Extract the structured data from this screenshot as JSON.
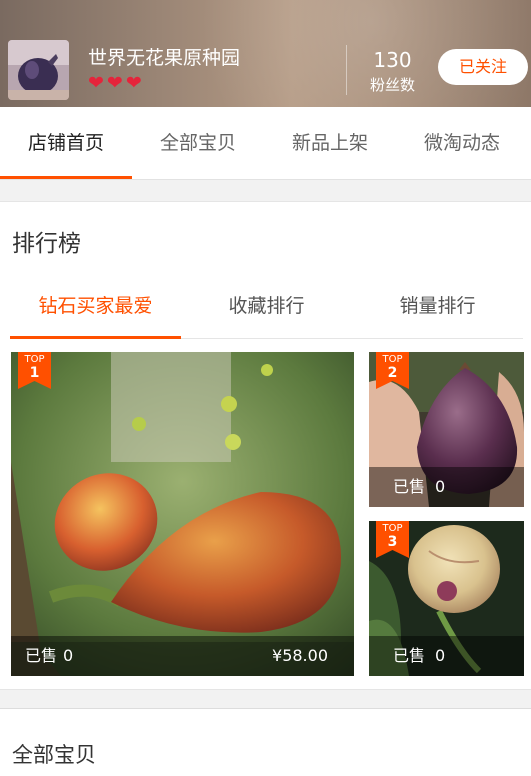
{
  "shop": {
    "name": "世界无花果原种园",
    "hearts": 3,
    "fans_count": "130",
    "fans_label": "粉丝数",
    "follow_label": "已关注"
  },
  "tabs": [
    "店铺首页",
    "全部宝贝",
    "新品上架",
    "微淘动态"
  ],
  "ranking": {
    "title": "排行榜",
    "tabs": [
      "钻石买家最爱",
      "收藏排行",
      "销量排行"
    ],
    "items": [
      {
        "badge_top": "TOP",
        "rank": "1",
        "sold_label": "已售",
        "sold_count": "0",
        "price": "¥58.00"
      },
      {
        "badge_top": "TOP",
        "rank": "2",
        "sold_label": "已售",
        "sold_count": "0"
      },
      {
        "badge_top": "TOP",
        "rank": "3",
        "sold_label": "已售",
        "sold_count": "0"
      }
    ]
  },
  "all_items": {
    "title": "全部宝贝"
  },
  "colors": {
    "accent": "#ff5000",
    "heart": "#e5243b"
  }
}
